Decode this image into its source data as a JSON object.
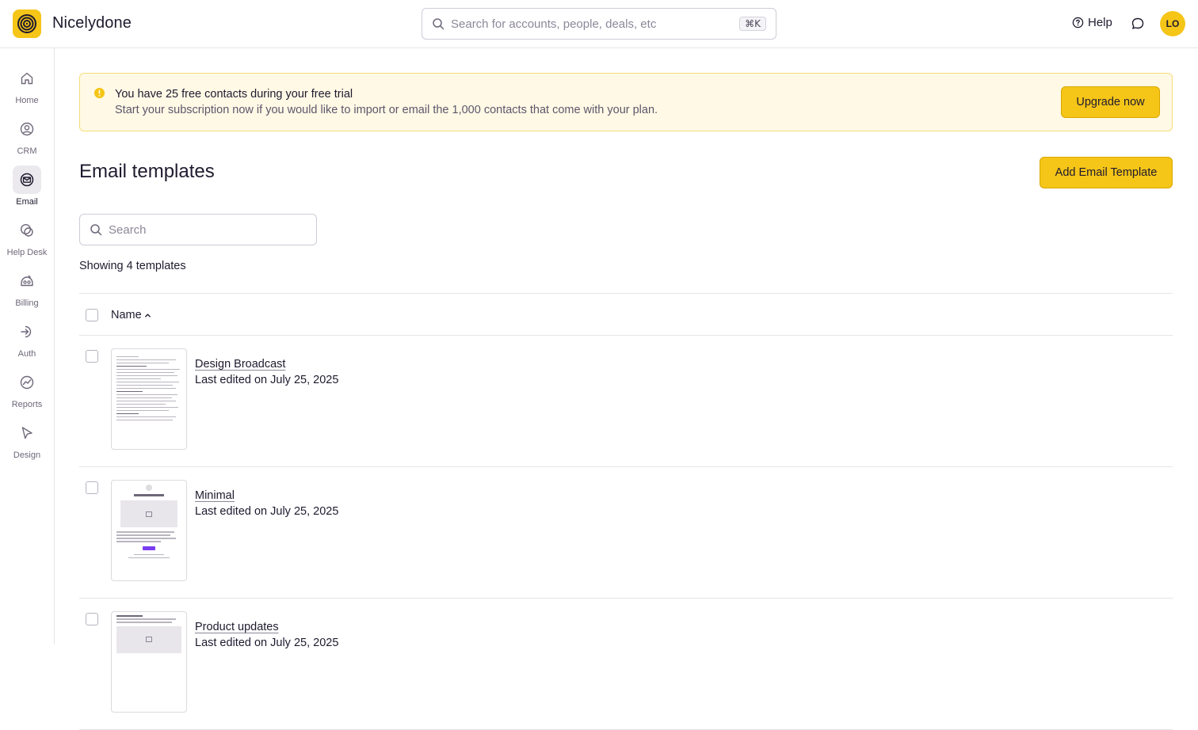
{
  "app": {
    "name": "Nicelydone"
  },
  "search": {
    "placeholder": "Search for accounts, people, deals, etc",
    "shortcut": "⌘K"
  },
  "header": {
    "help_label": "Help",
    "avatar_initials": "LO"
  },
  "sidebar": {
    "items": [
      {
        "label": "Home",
        "icon": "home-icon"
      },
      {
        "label": "CRM",
        "icon": "crm-icon"
      },
      {
        "label": "Email",
        "icon": "email-icon",
        "active": true
      },
      {
        "label": "Help Desk",
        "icon": "help-desk-icon"
      },
      {
        "label": "Billing",
        "icon": "billing-icon"
      },
      {
        "label": "Auth",
        "icon": "auth-icon"
      },
      {
        "label": "Reports",
        "icon": "reports-icon"
      },
      {
        "label": "Design",
        "icon": "design-icon"
      }
    ]
  },
  "banner": {
    "title": "You have 25 free contacts during your free trial",
    "text": "Start your subscription now if you would like to import or email the 1,000 contacts that come with your plan.",
    "button": "Upgrade now"
  },
  "page": {
    "title": "Email templates",
    "add_button": "Add Email Template",
    "search_placeholder": "Search",
    "showing": "Showing 4 templates"
  },
  "table": {
    "column_name": "Name",
    "rows": [
      {
        "name": "Design Broadcast",
        "edited": "Last edited on July 25, 2025"
      },
      {
        "name": "Minimal",
        "edited": "Last edited on July 25, 2025"
      },
      {
        "name": "Product updates",
        "edited": "Last edited on July 25, 2025"
      }
    ]
  },
  "colors": {
    "accent": "#f5c518",
    "banner_bg": "#fff9e6",
    "text": "#1f1a2e"
  }
}
